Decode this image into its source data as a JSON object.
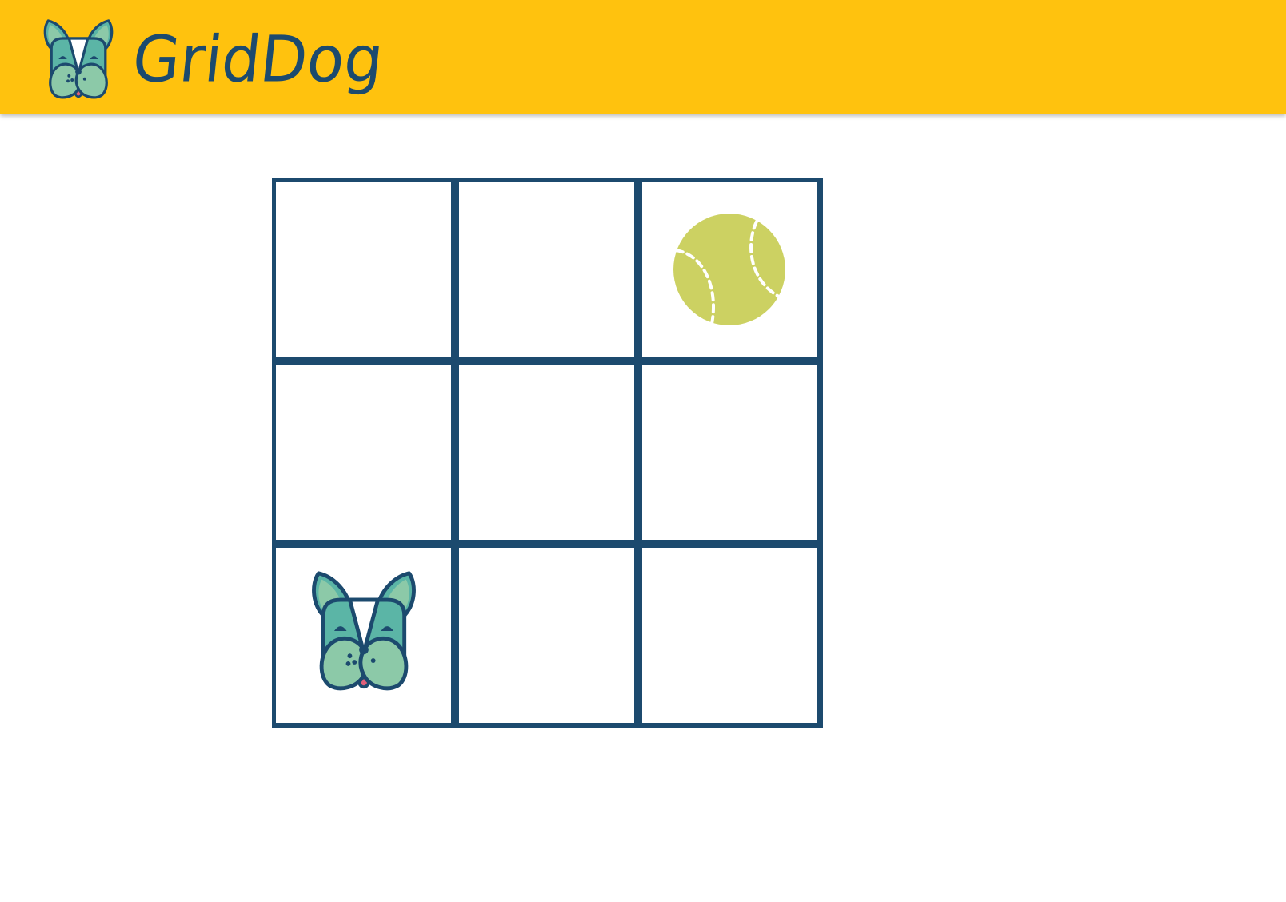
{
  "app": {
    "name": "GridDog",
    "logo_icon": "dog-face-icon"
  },
  "colors": {
    "header_bg": "#FFC20E",
    "grid_line": "#1C4A6E",
    "dog_fill": "#5BB5A6",
    "dog_snout": "#8CC9A8",
    "ball": "#CCD162",
    "tongue": "#E0607A"
  },
  "grid": {
    "rows": 3,
    "cols": 3,
    "dog": {
      "row": 3,
      "col": 1,
      "icon": "dog-face-icon"
    },
    "ball": {
      "row": 1,
      "col": 3,
      "icon": "tennis-ball-icon"
    }
  }
}
